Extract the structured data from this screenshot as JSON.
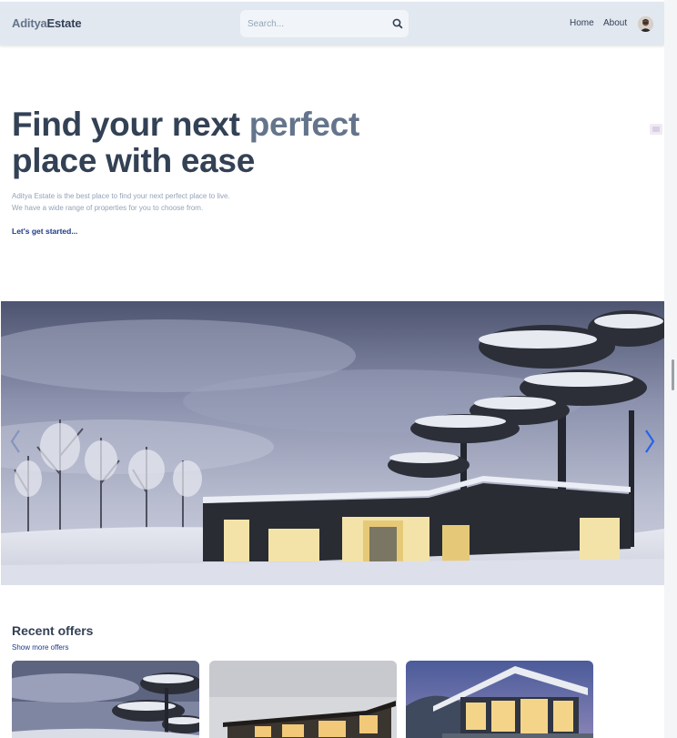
{
  "header": {
    "logo_part1": "Aditya",
    "logo_part2": "Estate",
    "search_placeholder": "Search...",
    "nav": {
      "home": "Home",
      "about": "About"
    }
  },
  "hero": {
    "title_line1": "Find your next ",
    "title_highlight": "perfect",
    "title_line2": "place with ease",
    "desc_line1": "Aditya Estate is the best place to find your next perfect place to live.",
    "desc_line2": "We have a wide range of properties for you to choose from.",
    "cta": "Let's get started..."
  },
  "slider": {
    "prev_icon": "chevron-left-icon",
    "next_icon": "chevron-right-icon",
    "image": "snowy-modern-cabin"
  },
  "offers": {
    "title": "Recent offers",
    "link": "Show more offers",
    "cards": [
      {
        "image": "snowy-cabin"
      },
      {
        "image": "modern-house-dusk"
      },
      {
        "image": "glass-villa-night"
      }
    ]
  },
  "colors": {
    "header_bg": "#e2e8f0",
    "text_dark": "#334155",
    "text_muted": "#64748b",
    "link_blue": "#1e3a8a",
    "arrow_blue": "#2563eb"
  }
}
